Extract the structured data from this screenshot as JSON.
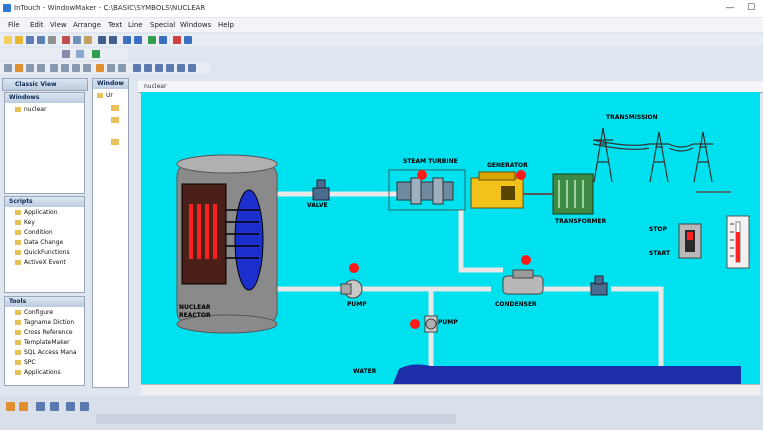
{
  "window": {
    "title": "InTouch - WindowMaker - C:\\BASIC\\SYMBOLS\\NUCLEAR",
    "minimize": "—",
    "maximize": "☐"
  },
  "menu": [
    "File",
    "Edit",
    "View",
    "Arrange",
    "Text",
    "Line",
    "Special",
    "Windows",
    "Help"
  ],
  "classic_view": {
    "title": "Classic View",
    "windows_header": "Windows",
    "windows_items": [
      "nuclear"
    ],
    "scripts_header": "Scripts",
    "scripts_items": [
      "Application",
      "Key",
      "Condition",
      "Data Change",
      "QuickFunctions",
      "ActiveX Event"
    ],
    "tools_header": "Tools",
    "tools_items": [
      "Configure",
      "Tagname Diction",
      "Cross Reference",
      "TemplateMaker",
      "SQL Access Mana",
      "SPC",
      "Applications"
    ]
  },
  "windows_panel": {
    "title": "Window",
    "item": "Ur"
  },
  "canvas_tab": {
    "label": "nuclear"
  },
  "diagram": {
    "labels": {
      "transmission": "TRANSMISSION",
      "steam_turbine": "STEAM TURBINE",
      "generator": "GENERATOR",
      "valve": "VALVE",
      "transformer": "TRANSFORMER",
      "stop": "STOP",
      "start": "START",
      "pump1": "PUMP",
      "pump2": "PUMP",
      "condenser": "CONDENSER",
      "reactor": "NUCLEAR\nREACTOR",
      "water": "WATER"
    },
    "colors": {
      "background": "#00e1f0",
      "pipe": "#e8e8e8",
      "indicator": "#ff1a1a",
      "water": "#1c2fa8"
    }
  }
}
